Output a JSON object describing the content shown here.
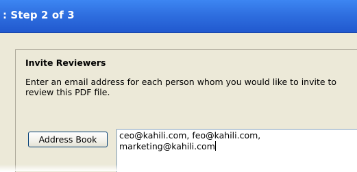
{
  "window": {
    "title": ": Step 2 of 3"
  },
  "section": {
    "heading": "Invite Reviewers",
    "description": "Enter an email address for each person whom you would like to invite to review this PDF file."
  },
  "address_book": {
    "label": "Address Book"
  },
  "recipients": {
    "line1": "ceo@kahili.com, feo@kahili.com,",
    "line2": "marketing@kahili.com"
  },
  "colors": {
    "titlebar": "#2f6fe0",
    "dialog_bg": "#ece9d8",
    "field_border": "#7f9db9"
  }
}
